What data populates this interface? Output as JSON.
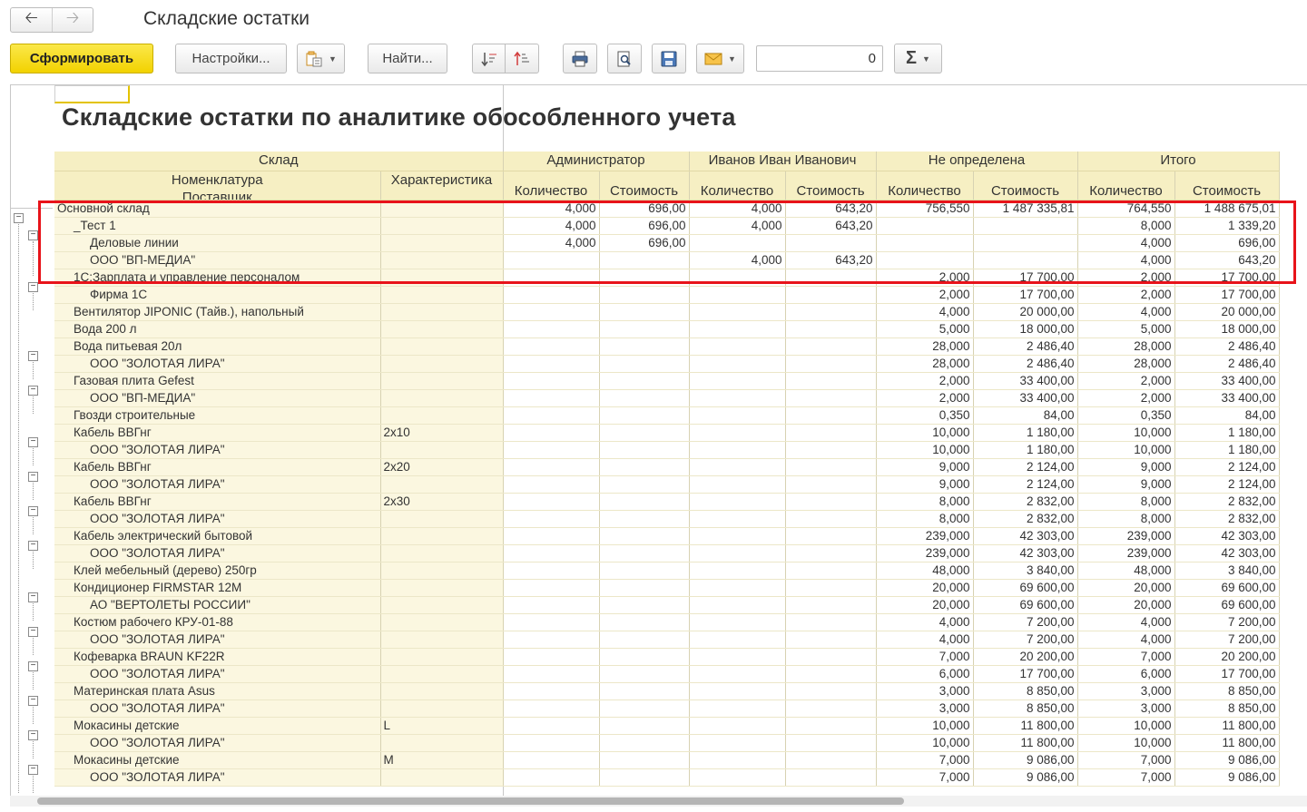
{
  "window": {
    "title": "Складские остатки"
  },
  "toolbar": {
    "generate": "Сформировать",
    "settings": "Настройки...",
    "find": "Найти...",
    "counter_value": "0",
    "sum_symbol": "Σ"
  },
  "report": {
    "title": "Складские остатки по аналитике обособленного учета",
    "headers": {
      "sklad": "Склад",
      "nomenklatura": "Номенклатура",
      "harakteristika": "Характеристика",
      "postavshik": "Поставщик",
      "groups": [
        "Администратор",
        "Иванов Иван Иванович",
        "Не определена",
        "Итого"
      ],
      "qty": "Количество",
      "cost": "Стоимость"
    },
    "rows": [
      {
        "level": 0,
        "name": "Основной склад",
        "char": "",
        "v": [
          "4,000",
          "696,00",
          "4,000",
          "643,20",
          "756,550",
          "1 487 335,81",
          "764,550",
          "1 488 675,01"
        ]
      },
      {
        "level": 1,
        "name": "_Тест 1",
        "char": "",
        "v": [
          "4,000",
          "696,00",
          "4,000",
          "643,20",
          "",
          "",
          "8,000",
          "1 339,20"
        ]
      },
      {
        "level": 2,
        "name": "Деловые линии",
        "char": "",
        "v": [
          "4,000",
          "696,00",
          "",
          "",
          "",
          "",
          "4,000",
          "696,00"
        ]
      },
      {
        "level": 2,
        "name": "ООО \"ВП-МЕДИА\"",
        "char": "",
        "v": [
          "",
          "",
          "4,000",
          "643,20",
          "",
          "",
          "4,000",
          "643,20"
        ]
      },
      {
        "level": 1,
        "name": "1С:Зарплата и управление персоналом",
        "char": "",
        "v": [
          "",
          "",
          "",
          "",
          "2,000",
          "17 700,00",
          "2,000",
          "17 700,00"
        ]
      },
      {
        "level": 2,
        "name": "Фирма 1С",
        "char": "",
        "v": [
          "",
          "",
          "",
          "",
          "2,000",
          "17 700,00",
          "2,000",
          "17 700,00"
        ]
      },
      {
        "level": 1,
        "name": "Вентилятор JIPONIC (Тайв.), напольный",
        "char": "",
        "v": [
          "",
          "",
          "",
          "",
          "4,000",
          "20 000,00",
          "4,000",
          "20 000,00"
        ]
      },
      {
        "level": 1,
        "name": "Вода 200 л",
        "char": "",
        "v": [
          "",
          "",
          "",
          "",
          "5,000",
          "18 000,00",
          "5,000",
          "18 000,00"
        ]
      },
      {
        "level": 1,
        "name": "Вода питьевая 20л",
        "char": "",
        "v": [
          "",
          "",
          "",
          "",
          "28,000",
          "2 486,40",
          "28,000",
          "2 486,40"
        ]
      },
      {
        "level": 2,
        "name": "ООО \"ЗОЛОТАЯ ЛИРА\"",
        "char": "",
        "v": [
          "",
          "",
          "",
          "",
          "28,000",
          "2 486,40",
          "28,000",
          "2 486,40"
        ]
      },
      {
        "level": 1,
        "name": "Газовая плита Gefest",
        "char": "",
        "v": [
          "",
          "",
          "",
          "",
          "2,000",
          "33 400,00",
          "2,000",
          "33 400,00"
        ]
      },
      {
        "level": 2,
        "name": "ООО \"ВП-МЕДИА\"",
        "char": "",
        "v": [
          "",
          "",
          "",
          "",
          "2,000",
          "33 400,00",
          "2,000",
          "33 400,00"
        ]
      },
      {
        "level": 1,
        "name": "Гвозди строительные",
        "char": "",
        "v": [
          "",
          "",
          "",
          "",
          "0,350",
          "84,00",
          "0,350",
          "84,00"
        ]
      },
      {
        "level": 1,
        "name": "Кабель ВВГнг",
        "char": "2х10",
        "v": [
          "",
          "",
          "",
          "",
          "10,000",
          "1 180,00",
          "10,000",
          "1 180,00"
        ]
      },
      {
        "level": 2,
        "name": "ООО \"ЗОЛОТАЯ ЛИРА\"",
        "char": "",
        "v": [
          "",
          "",
          "",
          "",
          "10,000",
          "1 180,00",
          "10,000",
          "1 180,00"
        ]
      },
      {
        "level": 1,
        "name": "Кабель ВВГнг",
        "char": "2х20",
        "v": [
          "",
          "",
          "",
          "",
          "9,000",
          "2 124,00",
          "9,000",
          "2 124,00"
        ]
      },
      {
        "level": 2,
        "name": "ООО \"ЗОЛОТАЯ ЛИРА\"",
        "char": "",
        "v": [
          "",
          "",
          "",
          "",
          "9,000",
          "2 124,00",
          "9,000",
          "2 124,00"
        ]
      },
      {
        "level": 1,
        "name": "Кабель ВВГнг",
        "char": "2х30",
        "v": [
          "",
          "",
          "",
          "",
          "8,000",
          "2 832,00",
          "8,000",
          "2 832,00"
        ]
      },
      {
        "level": 2,
        "name": "ООО \"ЗОЛОТАЯ ЛИРА\"",
        "char": "",
        "v": [
          "",
          "",
          "",
          "",
          "8,000",
          "2 832,00",
          "8,000",
          "2 832,00"
        ]
      },
      {
        "level": 1,
        "name": "Кабель электрический бытовой",
        "char": "",
        "v": [
          "",
          "",
          "",
          "",
          "239,000",
          "42 303,00",
          "239,000",
          "42 303,00"
        ]
      },
      {
        "level": 2,
        "name": "ООО \"ЗОЛОТАЯ ЛИРА\"",
        "char": "",
        "v": [
          "",
          "",
          "",
          "",
          "239,000",
          "42 303,00",
          "239,000",
          "42 303,00"
        ]
      },
      {
        "level": 1,
        "name": "Клей мебельный (дерево) 250гр",
        "char": "",
        "v": [
          "",
          "",
          "",
          "",
          "48,000",
          "3 840,00",
          "48,000",
          "3 840,00"
        ]
      },
      {
        "level": 1,
        "name": "Кондиционер FIRMSTAR 12M",
        "char": "",
        "v": [
          "",
          "",
          "",
          "",
          "20,000",
          "69 600,00",
          "20,000",
          "69 600,00"
        ]
      },
      {
        "level": 2,
        "name": "АО \"ВЕРТОЛЕТЫ РОССИИ\"",
        "char": "",
        "v": [
          "",
          "",
          "",
          "",
          "20,000",
          "69 600,00",
          "20,000",
          "69 600,00"
        ]
      },
      {
        "level": 1,
        "name": "Костюм рабочего КРУ-01-88",
        "char": "",
        "v": [
          "",
          "",
          "",
          "",
          "4,000",
          "7 200,00",
          "4,000",
          "7 200,00"
        ]
      },
      {
        "level": 2,
        "name": "ООО \"ЗОЛОТАЯ ЛИРА\"",
        "char": "",
        "v": [
          "",
          "",
          "",
          "",
          "4,000",
          "7 200,00",
          "4,000",
          "7 200,00"
        ]
      },
      {
        "level": 1,
        "name": "Кофеварка BRAUN KF22R",
        "char": "",
        "v": [
          "",
          "",
          "",
          "",
          "7,000",
          "20 200,00",
          "7,000",
          "20 200,00"
        ]
      },
      {
        "level": 2,
        "name": "ООО \"ЗОЛОТАЯ ЛИРА\"",
        "char": "",
        "v": [
          "",
          "",
          "",
          "",
          "6,000",
          "17 700,00",
          "6,000",
          "17 700,00"
        ]
      },
      {
        "level": 1,
        "name": "Материнская плата Asus",
        "char": "",
        "v": [
          "",
          "",
          "",
          "",
          "3,000",
          "8 850,00",
          "3,000",
          "8 850,00"
        ]
      },
      {
        "level": 2,
        "name": "ООО \"ЗОЛОТАЯ ЛИРА\"",
        "char": "",
        "v": [
          "",
          "",
          "",
          "",
          "3,000",
          "8 850,00",
          "3,000",
          "8 850,00"
        ]
      },
      {
        "level": 1,
        "name": "Мокасины детские",
        "char": "L",
        "v": [
          "",
          "",
          "",
          "",
          "10,000",
          "11 800,00",
          "10,000",
          "11 800,00"
        ]
      },
      {
        "level": 2,
        "name": "ООО \"ЗОЛОТАЯ ЛИРА\"",
        "char": "",
        "v": [
          "",
          "",
          "",
          "",
          "10,000",
          "11 800,00",
          "10,000",
          "11 800,00"
        ]
      },
      {
        "level": 1,
        "name": "Мокасины детские",
        "char": "M",
        "v": [
          "",
          "",
          "",
          "",
          "7,000",
          "9 086,00",
          "7,000",
          "9 086,00"
        ]
      },
      {
        "level": 2,
        "name": "ООО \"ЗОЛОТАЯ ЛИРА\"",
        "char": "",
        "v": [
          "",
          "",
          "",
          "",
          "7,000",
          "9 086,00",
          "7,000",
          "9 086,00"
        ]
      }
    ]
  },
  "colors": {
    "header_bg": "#f6efc3",
    "label_bg": "#fbf7e0",
    "highlight": "#e8131a",
    "primary_button": "#f2d200"
  },
  "icons": [
    "back-arrow-icon",
    "forward-arrow-icon",
    "variant-icon",
    "sort-ascending-icon",
    "sort-descending-icon",
    "print-icon",
    "preview-icon",
    "save-icon",
    "mail-icon",
    "sum-icon"
  ]
}
